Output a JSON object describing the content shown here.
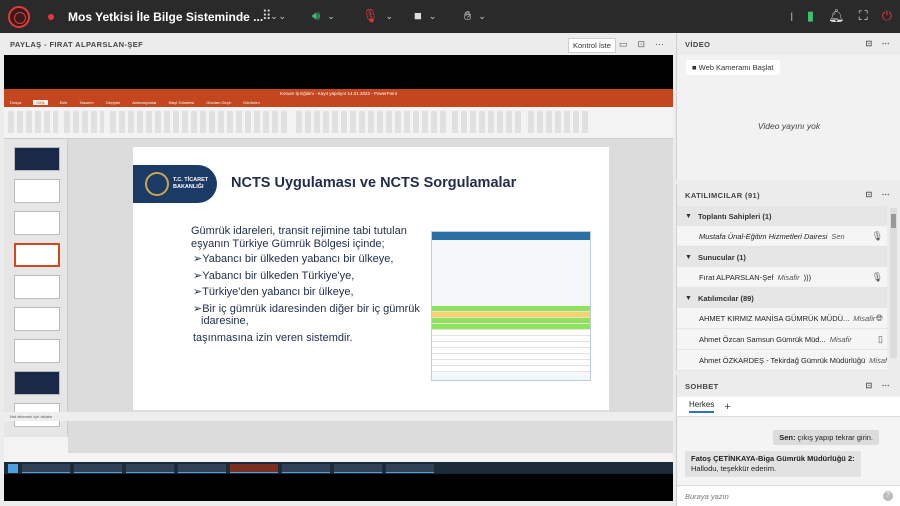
{
  "header": {
    "meeting_title": "Mos Yetkisi İle Bilge Sisteminde ...",
    "icons": [
      "apps-grid-icon",
      "speaker-icon",
      "mic-muted-icon",
      "camera-icon",
      "raise-hand-icon",
      "signal-icon",
      "notification-icon",
      "fullscreen-icon",
      "power-icon"
    ]
  },
  "share_pod": {
    "title": "PAYLAŞ - FIRAT ALPARSLAN-ŞEF",
    "control_button": "Kontrol İste"
  },
  "ppt": {
    "window_title": "Konum İş Eğitimi - Kayıt yapılıyor 14.01.2022 - PowerPoint",
    "tabs": [
      "Dosya",
      "Giriş",
      "Ekle",
      "Tasarım",
      "Geçişler",
      "Animasyonlar",
      "Slayt Gösterisi",
      "Gözden Geçir",
      "Görünüm"
    ],
    "active_tab": "Giriş",
    "notes_placeholder": "Not eklemek için tıklatın",
    "slide": {
      "banner_text": "T.C. TİCARET BAKANLIĞI",
      "title": "NCTS Uygulaması ve NCTS Sorgulamalar",
      "intro": "Gümrük idareleri, transit rejimine tabi tutulan eşyanın Türkiye Gümrük Bölgesi içinde;",
      "bullets": [
        "➢Yabancı bir ülkeden yabancı bir ülkeye,",
        "➢Yabancı bir ülkeden Türkiye'ye,",
        "➢Türkiye'den yabancı bir ülkeye,",
        "➢Bir iç gümrük idaresinden diğer bir iç gümrük idaresine,"
      ],
      "closing": "taşınmasına izin veren sistemdir."
    }
  },
  "video_pod": {
    "title": "VİDEO",
    "webcam_button": "Web Kameramı Başlat",
    "no_video": "Video yayını yok"
  },
  "attendees_pod": {
    "title": "KATILIMCILAR (91)",
    "hosts_header": "Toplantı Sahipleri (1)",
    "hosts": [
      {
        "name": "Mustafa Ünal-Eğitim Hizmetleri Dairesi",
        "role": "Sen"
      }
    ],
    "presenters_header": "Sunucular (1)",
    "presenters": [
      {
        "name": "Fırat ALPARSLAN-Şef",
        "role": "Misafir"
      }
    ],
    "participants_header": "Katılımcılar (89)",
    "participants": [
      {
        "name": "AHMET KIRMIZ MANİSA GÜMRÜK MÜDÜ...",
        "role": "Misafir"
      },
      {
        "name": "Ahmet Özcan Samsun Gümrük Müd...",
        "role": "Misafir"
      },
      {
        "name": "Ahmet ÖZKARDEŞ - Tekirdağ Gümrük Müdürlüğü",
        "role": "Misafir"
      }
    ]
  },
  "chat_pod": {
    "title": "SOHBET",
    "tab": "Herkes",
    "my_message_sender": "Sen:",
    "my_message": "çıkış yapıp tekrar girin.",
    "other_message_sender": "Fatoş ÇETİNKAYA-Biga Gümrük Müdürlüğü 2:",
    "other_message": "Hallodu, teşekkür ederim.",
    "input_placeholder": "Buraya yazın"
  }
}
